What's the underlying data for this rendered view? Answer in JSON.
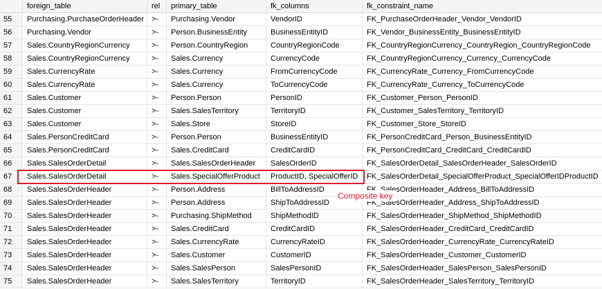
{
  "columns": [
    "",
    "foreign_table",
    "rel",
    "primary_table",
    "fk_columns",
    "fk_constraint_name"
  ],
  "rows": [
    [
      "55",
      "Purchasing.PurchaseOrderHeader",
      ">-",
      "Purchasing.Vendor",
      "VendorID",
      "FK_PurchaseOrderHeader_Vendor_VendorID"
    ],
    [
      "56",
      "Purchasing.Vendor",
      ">-",
      "Person.BusinessEntity",
      "BusinessEntityID",
      "FK_Vendor_BusinessEntity_BusinessEntityID"
    ],
    [
      "57",
      "Sales.CountryRegionCurrency",
      ">-",
      "Person.CountryRegion",
      "CountryRegionCode",
      "FK_CountryRegionCurrency_CountryRegion_CountryRegionCode"
    ],
    [
      "58",
      "Sales.CountryRegionCurrency",
      ">-",
      "Sales.Currency",
      "CurrencyCode",
      "FK_CountryRegionCurrency_Currency_CurrencyCode"
    ],
    [
      "59",
      "Sales.CurrencyRate",
      ">-",
      "Sales.Currency",
      "FromCurrencyCode",
      "FK_CurrencyRate_Currency_FromCurrencyCode"
    ],
    [
      "60",
      "Sales.CurrencyRate",
      ">-",
      "Sales.Currency",
      "ToCurrencyCode",
      "FK_CurrencyRate_Currency_ToCurrencyCode"
    ],
    [
      "61",
      "Sales.Customer",
      ">-",
      "Person.Person",
      "PersonID",
      "FK_Customer_Person_PersonID"
    ],
    [
      "62",
      "Sales.Customer",
      ">-",
      "Sales.SalesTerritory",
      "TerritoryID",
      "FK_Customer_SalesTerritory_TerritoryID"
    ],
    [
      "63",
      "Sales.Customer",
      ">-",
      "Sales.Store",
      "StoreID",
      "FK_Customer_Store_StoreID"
    ],
    [
      "64",
      "Sales.PersonCreditCard",
      ">-",
      "Person.Person",
      "BusinessEntityID",
      "FK_PersonCreditCard_Person_BusinessEntityID"
    ],
    [
      "65",
      "Sales.PersonCreditCard",
      ">-",
      "Sales.CreditCard",
      "CreditCardID",
      "FK_PersonCreditCard_CreditCard_CreditCardID"
    ],
    [
      "66",
      "Sales.SalesOrderDetail",
      ">-",
      "Sales.SalesOrderHeader",
      "SalesOrderID",
      "FK_SalesOrderDetail_SalesOrderHeader_SalesOrderID"
    ],
    [
      "67",
      "Sales.SalesOrderDetail",
      ">-",
      "Sales.SpecialOfferProduct",
      "ProductID, SpecialOfferID",
      "FK_SalesOrderDetail_SpecialOfferProduct_SpecialOfferIDProductID"
    ],
    [
      "68",
      "Sales.SalesOrderHeader",
      ">-",
      "Person.Address",
      "BillToAddressID",
      "FK_SalesOrderHeader_Address_BillToAddressID"
    ],
    [
      "69",
      "Sales.SalesOrderHeader",
      ">-",
      "Person.Address",
      "ShipToAddressID",
      "FK_SalesOrderHeader_Address_ShipToAddressID"
    ],
    [
      "70",
      "Sales.SalesOrderHeader",
      ">-",
      "Purchasing.ShipMethod",
      "ShipMethodID",
      "FK_SalesOrderHeader_ShipMethod_ShipMethodID"
    ],
    [
      "71",
      "Sales.SalesOrderHeader",
      ">-",
      "Sales.CreditCard",
      "CreditCardID",
      "FK_SalesOrderHeader_CreditCard_CreditCardID"
    ],
    [
      "72",
      "Sales.SalesOrderHeader",
      ">-",
      "Sales.CurrencyRate",
      "CurrencyRateID",
      "FK_SalesOrderHeader_CurrencyRate_CurrencyRateID"
    ],
    [
      "73",
      "Sales.SalesOrderHeader",
      ">-",
      "Sales.Customer",
      "CustomerID",
      "FK_SalesOrderHeader_Customer_CustomerID"
    ],
    [
      "74",
      "Sales.SalesOrderHeader",
      ">-",
      "Sales.SalesPerson",
      "SalesPersonID",
      "FK_SalesOrderHeader_SalesPerson_SalesPersonID"
    ],
    [
      "75",
      "Sales.SalesOrderHeader",
      ">-",
      "Sales.SalesTerritory",
      "TerritoryID",
      "FK_SalesOrderHeader_SalesTerritory_TerritoryID"
    ]
  ],
  "annotation": {
    "label": "Composite key",
    "color": "#e0182c"
  }
}
